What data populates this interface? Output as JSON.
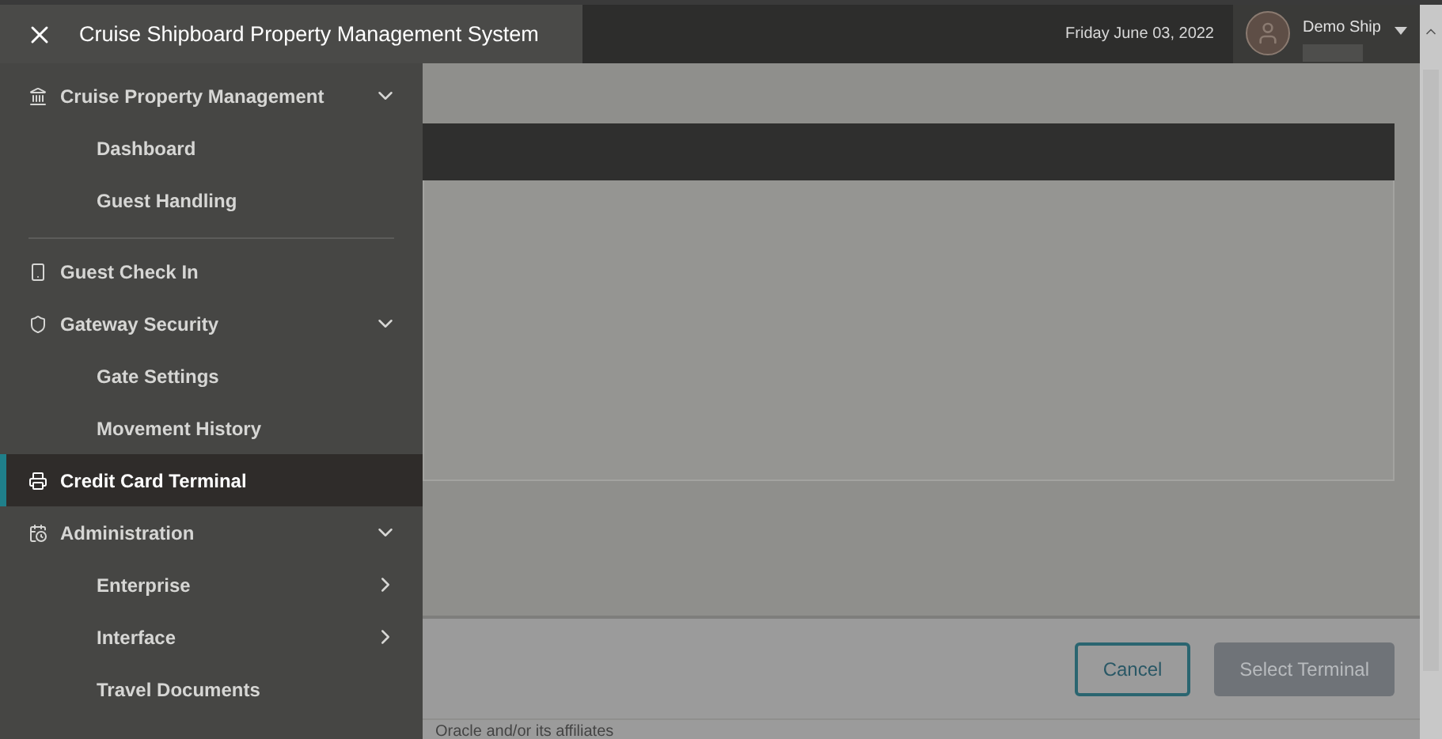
{
  "header": {
    "title": "Cruise Shipboard Property Management System",
    "date": "Friday June 03, 2022",
    "user": {
      "name": "Demo Ship"
    }
  },
  "sidebar": {
    "sections": [
      {
        "items": [
          {
            "label": "Cruise Property Management",
            "selected": false,
            "expanded": true,
            "children": [
              {
                "label": "Dashboard",
                "selected": false
              },
              {
                "label": "Guest Handling",
                "selected": false
              }
            ]
          }
        ]
      },
      {
        "items": [
          {
            "label": "Guest Check In",
            "selected": false
          },
          {
            "label": "Gateway Security",
            "selected": false,
            "expanded": true,
            "children": [
              {
                "label": "Gate Settings",
                "selected": false
              },
              {
                "label": "Movement History",
                "selected": false
              }
            ]
          },
          {
            "label": "Credit Card Terminal",
            "selected": true
          },
          {
            "label": "Administration",
            "selected": false,
            "expanded": true,
            "children": [
              {
                "label": "Enterprise",
                "selected": false,
                "expanded": false
              },
              {
                "label": "Interface",
                "selected": false,
                "expanded": false
              },
              {
                "label": "Travel Documents",
                "selected": false
              }
            ]
          }
        ]
      }
    ]
  },
  "dialog": {
    "buttons": [
      {
        "label": "Cancel",
        "disabled": false
      },
      {
        "label": "Select Terminal",
        "disabled": true
      }
    ]
  },
  "footer": {
    "text": "Oracle and/or its affiliates"
  }
}
